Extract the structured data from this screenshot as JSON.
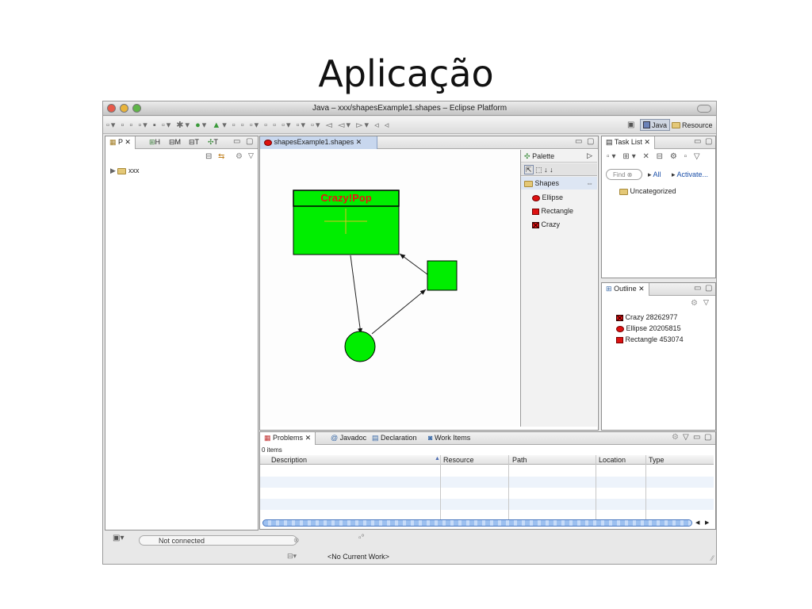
{
  "slide": {
    "title": "Aplicação"
  },
  "window": {
    "title": "Java – xxx/shapesExample1.shapes – Eclipse Platform"
  },
  "perspectives": [
    {
      "label": "Java",
      "active": true
    },
    {
      "label": "Resource",
      "active": false
    }
  ],
  "navigator": {
    "tabs": [
      "P",
      "H",
      "M",
      "T",
      "T"
    ],
    "tree": [
      {
        "label": "xxx"
      }
    ]
  },
  "editor": {
    "tab": "shapesExample1.shapes",
    "diagram": {
      "crazy_label": "Crazy!Pop",
      "fill_color": "#00ee00",
      "label_color": "#ee1111"
    },
    "palette": {
      "title": "Palette",
      "drawer": "Shapes",
      "items": [
        "Ellipse",
        "Rectangle",
        "Crazy"
      ]
    }
  },
  "tasklist": {
    "tab": "Task List",
    "find_placeholder": "Find",
    "all": "All",
    "activate": "Activate...",
    "category": "Uncategorized"
  },
  "outline": {
    "tab": "Outline",
    "items": [
      "Crazy 28262977",
      "Ellipse 20205815",
      "Rectangle 453074"
    ]
  },
  "problems": {
    "tabs": [
      "Problems",
      "Javadoc",
      "Declaration",
      "Work Items"
    ],
    "count": "0 items",
    "columns": [
      "Description",
      "Resource",
      "Path",
      "Location",
      "Type"
    ]
  },
  "status": {
    "connection": "Not connected",
    "work": "<No Current Work>"
  }
}
